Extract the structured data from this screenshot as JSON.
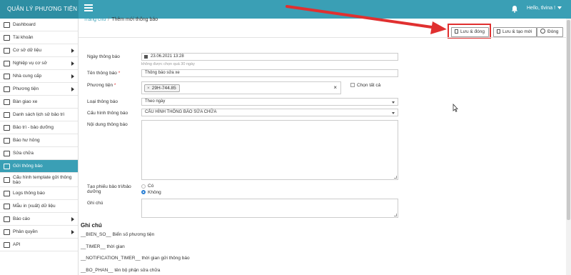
{
  "header": {
    "brand": "QUẢN LÝ PHƯƠNG TIỆN",
    "hello": "Hello, tlvina !"
  },
  "sidebar": {
    "items": [
      {
        "label": "Dashboard",
        "icon": "monitor-icon",
        "arrow": false,
        "active": false
      },
      {
        "label": "Tài khoản",
        "icon": "users-icon",
        "arrow": false,
        "active": false
      },
      {
        "label": "Cơ sở dữ liệu",
        "icon": "list-icon",
        "arrow": true,
        "active": false
      },
      {
        "label": "Nghiệp vụ cơ sở",
        "icon": "settings-icon",
        "arrow": true,
        "active": false
      },
      {
        "label": "Nhà cung cấp",
        "icon": "handshake-icon",
        "arrow": true,
        "active": false
      },
      {
        "label": "Phương tiện",
        "icon": "truck-icon",
        "arrow": true,
        "active": false
      },
      {
        "label": "Bàn giao xe",
        "icon": "car-icon",
        "arrow": false,
        "active": false
      },
      {
        "label": "Danh sách lịch sử bảo trì",
        "icon": "wrench-icon",
        "arrow": false,
        "active": false
      },
      {
        "label": "Bảo trì - bảo dưỡng",
        "icon": "book-icon",
        "arrow": false,
        "active": false
      },
      {
        "label": "Báo hư hỏng",
        "icon": "tools-icon",
        "arrow": false,
        "active": false
      },
      {
        "label": "Sửa chữa",
        "icon": "hammer-icon",
        "arrow": false,
        "active": false
      },
      {
        "label": "Gửi thông báo",
        "icon": "send-icon",
        "arrow": false,
        "active": true
      },
      {
        "label": "Cấu hình template gửi thông báo",
        "icon": "template-icon",
        "arrow": false,
        "active": false
      },
      {
        "label": "Logs thông báo",
        "icon": "file-icon",
        "arrow": false,
        "active": false
      },
      {
        "label": "Mẫu in (xuất) dữ liệu",
        "icon": "print-icon",
        "arrow": false,
        "active": false
      },
      {
        "label": "Báo cáo",
        "icon": "report-icon",
        "arrow": true,
        "active": false
      },
      {
        "label": "Phân quyền",
        "icon": "sitemap-icon",
        "arrow": true,
        "active": false
      },
      {
        "label": "API",
        "icon": "api-icon",
        "arrow": false,
        "active": false
      }
    ]
  },
  "breadcrumb": {
    "home": "Trang chủ",
    "current": "Thêm mới thông báo"
  },
  "toolbar": {
    "save_close": "Lưu & đóng",
    "save_new": "Lưu & tạo mới",
    "close": "Đóng"
  },
  "form": {
    "date_label": "Ngày thông báo",
    "date_value": "23.06.2021 13:28",
    "date_hint": "không được chọn quá 30 ngày",
    "name_label": "Tên thông báo",
    "name_value": "Thông báo sửa xe",
    "vehicle_label": "Phương tiện",
    "vehicle_tag": "29H-744.85",
    "select_all": "Chọn tất cả",
    "type_label": "Loại thông báo",
    "type_value": "Theo ngày",
    "config_label": "Cấu hình thông báo",
    "config_value": "CẤU HÌNH THÔNG BÁO SỬA CHỮA",
    "content_label": "Nội dung thông báo",
    "ticket_label": "Tạo phiếu bảo trì/bảo dưỡng",
    "opt_yes": "Có",
    "opt_no": "Không",
    "ticket_selected": "Không",
    "note_label": "Ghi chú"
  },
  "notes": {
    "title": "Ghi chú",
    "items": [
      "__BIEN_SO__ Biển số phương tiện",
      "__TIMER__ thời gian",
      "__NOTIFICATION_TIMER__ thời gian gửi thông báo",
      "__BO_PHAN__ tên bộ phận sửa chữa"
    ]
  },
  "colors": {
    "header": "#3a9fb5",
    "active": "#3a9fb5",
    "annotation": "#e03030"
  }
}
